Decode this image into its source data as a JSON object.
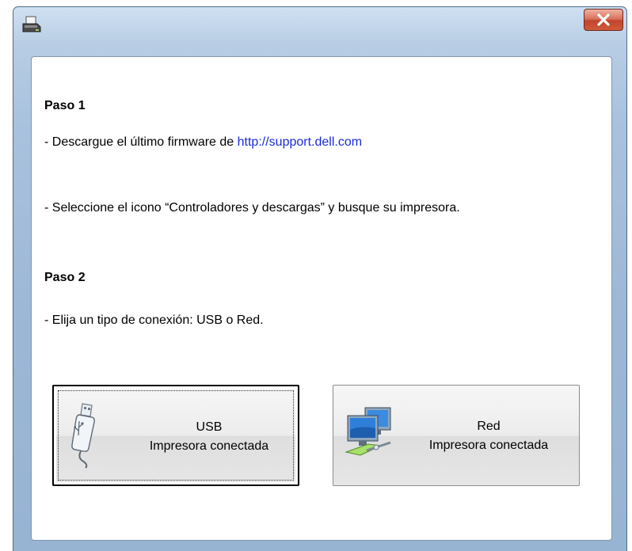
{
  "window": {
    "close_glyph": "X"
  },
  "step1": {
    "heading": "Paso 1",
    "download_prefix": "- Descargue el último firmware de ",
    "download_link": "http://support.dell.com",
    "select_text": "- Seleccione el icono “Controladores y descargas” y busque su impresora."
  },
  "step2": {
    "heading": "Paso 2",
    "choose_text": "- Elija un tipo de conexión: USB o Red."
  },
  "buttons": {
    "usb": {
      "title": "USB",
      "subtitle": "Impresora conectada",
      "icon": "usb-drive-icon"
    },
    "network": {
      "title": "Red",
      "subtitle": "Impresora conectada",
      "icon": "network-computers-icon"
    }
  },
  "colors": {
    "link": "#1a2bd6",
    "close_button": "#c2452c",
    "titlebar": "#b8cde4"
  }
}
